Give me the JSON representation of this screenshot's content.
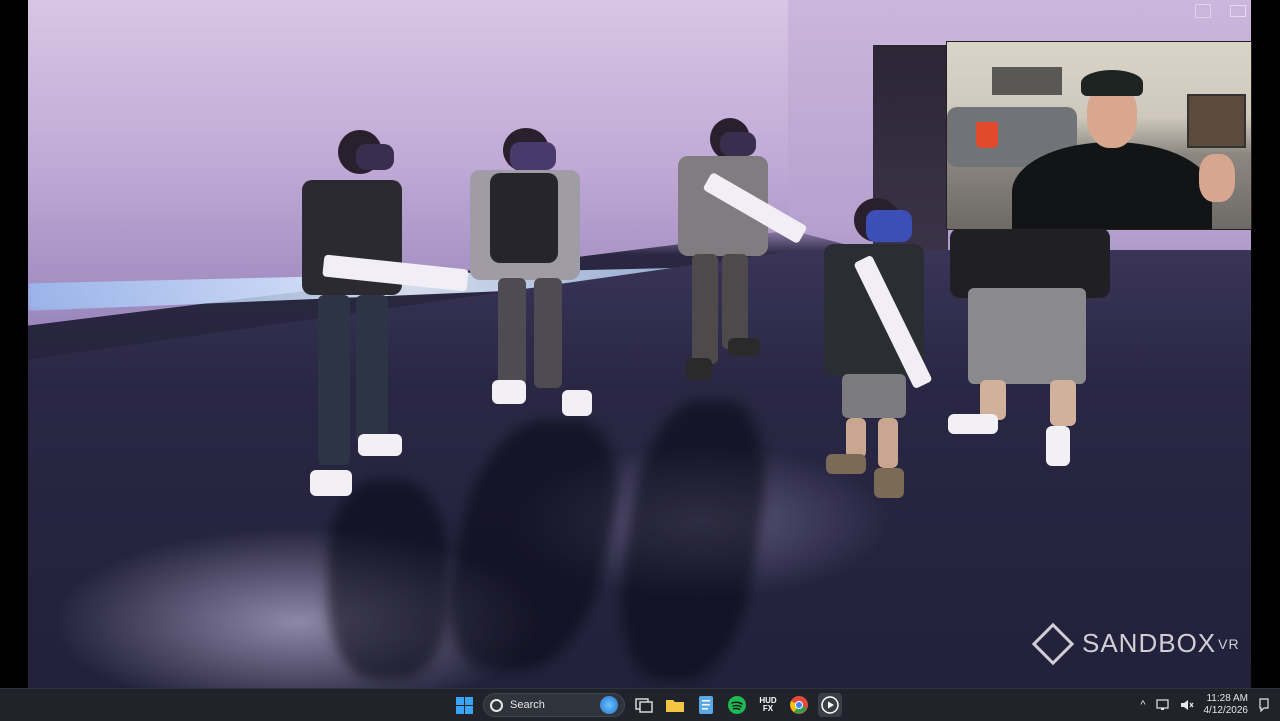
{
  "video": {
    "brand_logo": "SANDBOX",
    "brand_logo_sup": "VR"
  },
  "taskbar": {
    "search_label": "Search",
    "apps": [
      {
        "name": "task-view",
        "color": "#d8d8d8"
      },
      {
        "name": "file-explorer",
        "color": "#f4c542"
      },
      {
        "name": "notepad",
        "color": "#5aa9e6"
      },
      {
        "name": "spotify",
        "color": "#1db954"
      },
      {
        "name": "hudfx",
        "color": "#ffffff"
      },
      {
        "name": "chrome",
        "color": "#e44b3b"
      },
      {
        "name": "media-player",
        "color": "#ffffff"
      }
    ],
    "hudfx_label": "HUD FX",
    "time": "11:28 AM",
    "date": "4/12/2026"
  },
  "colors": {
    "wall": "#bfa9d6",
    "floor": "#2a2744",
    "accent_glow": "#cfe4ff",
    "taskbar": "#20232a"
  }
}
